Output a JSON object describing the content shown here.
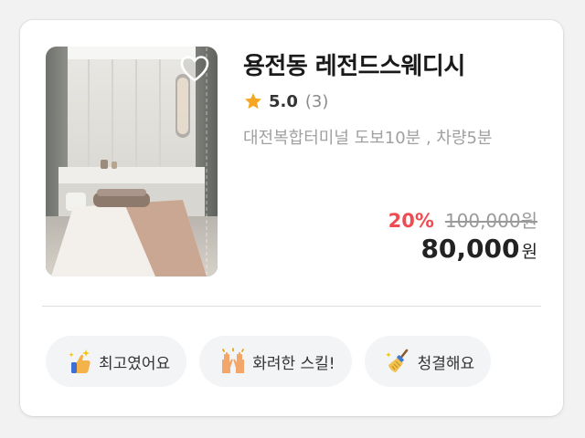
{
  "listing": {
    "title": "용전동 레전드스웨디시",
    "rating": "5.0",
    "review_count": "(3)",
    "location": "대전복합터미널 도보10분 , 차량5분",
    "discount": "20%",
    "original_price": "100,000원",
    "final_price": "80,000",
    "currency": "원"
  },
  "icons": {
    "favorite": "heart-outline-icon",
    "rating": "star-icon"
  },
  "colors": {
    "discount": "#ef4b52",
    "star": "#f5a623",
    "tag_bg": "#f3f4f6"
  },
  "tags": [
    {
      "label": "최고였어요",
      "icon": "thumbs-up-sparkle-icon"
    },
    {
      "label": "화려한 스킬!",
      "icon": "raised-hands-icon"
    },
    {
      "label": "청결해요",
      "icon": "broom-icon"
    }
  ]
}
